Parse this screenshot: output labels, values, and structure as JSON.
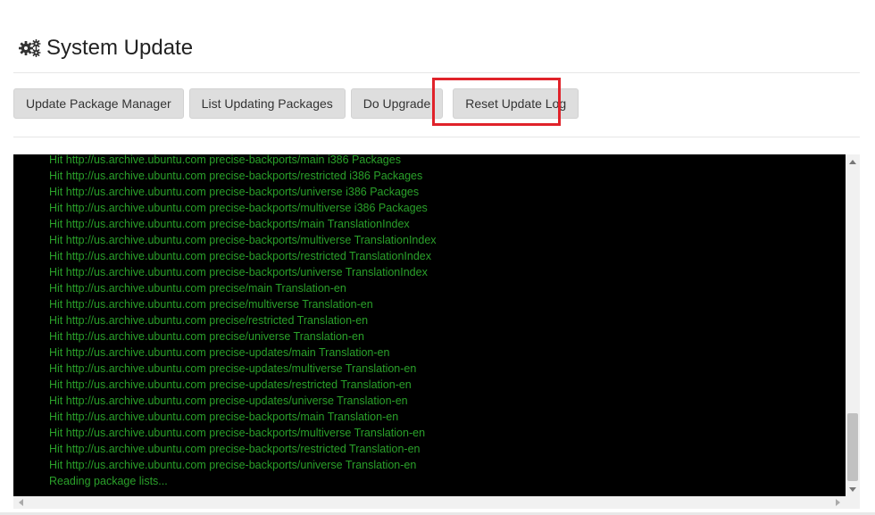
{
  "header": {
    "title": "System Update",
    "icon": "cogs-icon"
  },
  "toolbar": {
    "buttons": [
      {
        "label": "Update Package Manager"
      },
      {
        "label": "List Updating Packages"
      },
      {
        "label": "Do Upgrade"
      },
      {
        "label": "Reset Update Log"
      }
    ],
    "highlight_color": "#e0222a"
  },
  "console": {
    "background": "#000000",
    "text_color": "#2aa12a",
    "lines": [
      "Hit http://us.archive.ubuntu.com precise-backports/main i386 Packages",
      "Hit http://us.archive.ubuntu.com precise-backports/restricted i386 Packages",
      "Hit http://us.archive.ubuntu.com precise-backports/universe i386 Packages",
      "Hit http://us.archive.ubuntu.com precise-backports/multiverse i386 Packages",
      "Hit http://us.archive.ubuntu.com precise-backports/main TranslationIndex",
      "Hit http://us.archive.ubuntu.com precise-backports/multiverse TranslationIndex",
      "Hit http://us.archive.ubuntu.com precise-backports/restricted TranslationIndex",
      "Hit http://us.archive.ubuntu.com precise-backports/universe TranslationIndex",
      "Hit http://us.archive.ubuntu.com precise/main Translation-en",
      "Hit http://us.archive.ubuntu.com precise/multiverse Translation-en",
      "Hit http://us.archive.ubuntu.com precise/restricted Translation-en",
      "Hit http://us.archive.ubuntu.com precise/universe Translation-en",
      "Hit http://us.archive.ubuntu.com precise-updates/main Translation-en",
      "Hit http://us.archive.ubuntu.com precise-updates/multiverse Translation-en",
      "Hit http://us.archive.ubuntu.com precise-updates/restricted Translation-en",
      "Hit http://us.archive.ubuntu.com precise-updates/universe Translation-en",
      "Hit http://us.archive.ubuntu.com precise-backports/main Translation-en",
      "Hit http://us.archive.ubuntu.com precise-backports/multiverse Translation-en",
      "Hit http://us.archive.ubuntu.com precise-backports/restricted Translation-en",
      "Hit http://us.archive.ubuntu.com precise-backports/universe Translation-en",
      "Reading package lists..."
    ]
  }
}
